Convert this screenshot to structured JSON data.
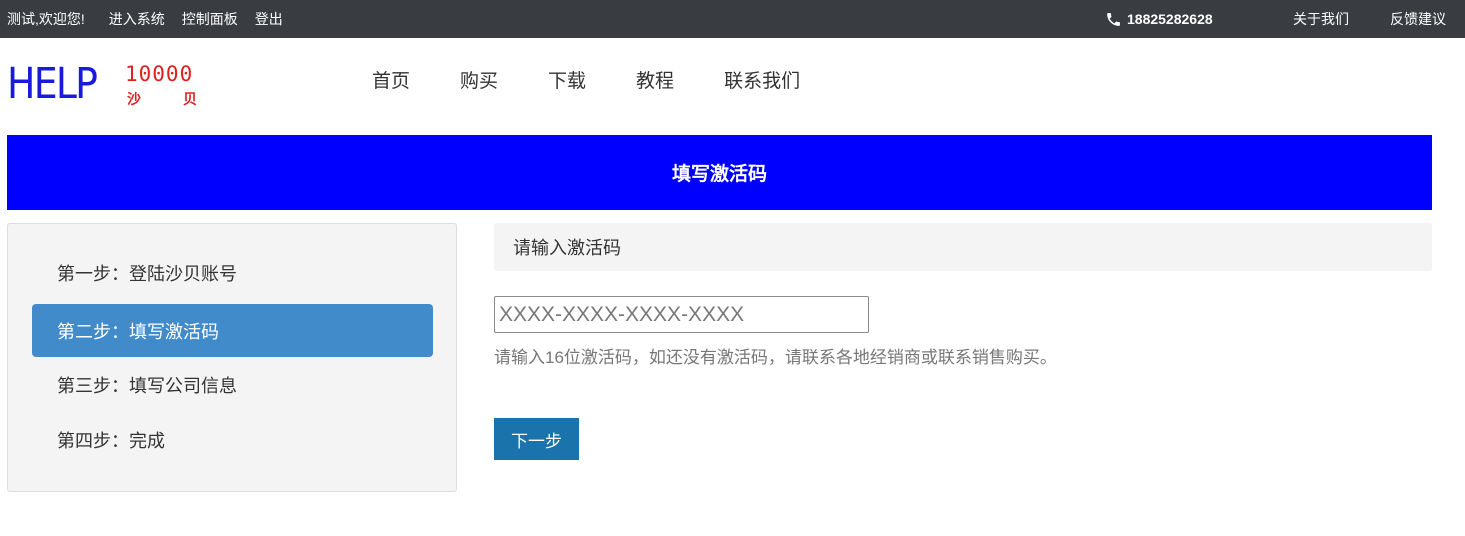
{
  "topbar": {
    "welcome": "测试,欢迎您!",
    "links": [
      "进入系统",
      "控制面板",
      "登出"
    ],
    "phone": "18825282628",
    "phone_icon": "phone-icon",
    "about": "关于我们",
    "feedback": "反馈建议",
    "bg_color": "#393c40"
  },
  "logo": {
    "help": "HELP",
    "number": "10000",
    "cn_left": "沙",
    "cn_right": "贝"
  },
  "nav": {
    "items": [
      "首页",
      "购买",
      "下载",
      "教程",
      "联系我们"
    ]
  },
  "banner": {
    "title": "填写激活码",
    "color": "#0000ff"
  },
  "steps": {
    "items": [
      {
        "label": "第一步：登陆沙贝账号",
        "active": false
      },
      {
        "label": "第二步：填写激活码",
        "active": true
      },
      {
        "label": "第三步：填写公司信息",
        "active": false
      },
      {
        "label": "第四步：完成",
        "active": false
      }
    ],
    "active_color": "#428bca"
  },
  "form": {
    "heading": "请输入激活码",
    "input_value": "",
    "input_placeholder": "XXXX-XXXX-XXXX-XXXX",
    "help_text": "请输入16位激活码，如还没有激活码，请联系各地经销商或联系销售购买。",
    "next_label": "下一步",
    "button_color": "#1a73aa"
  }
}
